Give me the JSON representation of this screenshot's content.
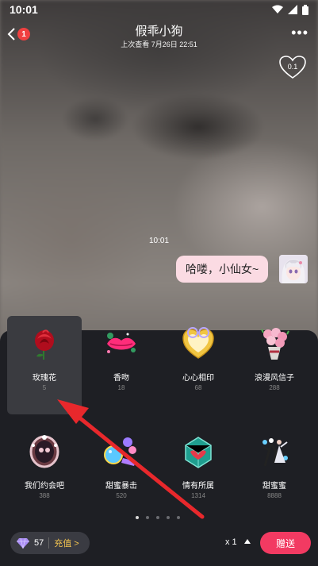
{
  "status_bar": {
    "time": "10:01"
  },
  "header": {
    "badge": "1",
    "title": "假乖小狗",
    "subtitle": "上次查看 7月26日 22:51",
    "more": "•••"
  },
  "intimacy": {
    "value": "0.1"
  },
  "chat": {
    "time": "10:01",
    "message": "哈喽，小仙女~"
  },
  "gifts": [
    {
      "name": "玫瑰花",
      "price": "5",
      "icon": "rose-icon"
    },
    {
      "name": "香吻",
      "price": "18",
      "icon": "kiss-lips-icon"
    },
    {
      "name": "心心相印",
      "price": "68",
      "icon": "heart-rings-icon"
    },
    {
      "name": "浪漫风信子",
      "price": "288",
      "icon": "flower-bouquet-icon"
    },
    {
      "name": "我们约会吧",
      "price": "388",
      "icon": "date-mirror-icon"
    },
    {
      "name": "甜蜜暴击",
      "price": "520",
      "icon": "candy-balloon-icon"
    },
    {
      "name": "情有所属",
      "price": "1314",
      "icon": "magic-box-icon"
    },
    {
      "name": "甜蜜蜜",
      "price": "8888",
      "icon": "dancing-couple-icon"
    }
  ],
  "pagination": {
    "pages": 5,
    "current": 1
  },
  "footer": {
    "diamonds": "57",
    "recharge_label": "充值 >",
    "quantity": "x 1",
    "send_label": "赠送"
  },
  "colors": {
    "send_button": "#f23a62",
    "bubble": "#fbdbe3",
    "recharge_text": "#f3c450",
    "panel": "#1e1f24"
  }
}
